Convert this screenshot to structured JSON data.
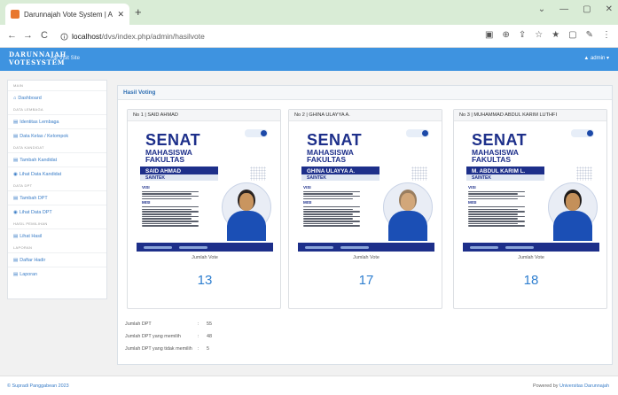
{
  "browser": {
    "tab_title": "Darunnajah Vote System | Admi",
    "tab_close": "✕",
    "new_tab": "+",
    "window_controls": [
      "⌄",
      "—",
      "▢",
      "✕"
    ],
    "back": "←",
    "forward": "→",
    "reload": "C",
    "url_host": "localhost",
    "url_path": "/dvs/index.php/admin/hasilvote",
    "addr_icons": [
      "▣",
      "⊕",
      "⇪",
      "☆",
      "★",
      "▢",
      "✎",
      "⋮"
    ]
  },
  "navbar": {
    "brand_line1": "DARUNNAJAH",
    "brand_line2": "VOTESYSTEM",
    "visit_site": "Visit Site",
    "user": "admin"
  },
  "sidebar": {
    "items": [
      {
        "type": "header",
        "label": "MAIN"
      },
      {
        "type": "link",
        "icon": "home-icon",
        "label": "Dashboard"
      },
      {
        "type": "header",
        "label": "DATA LEMBAGA"
      },
      {
        "type": "link",
        "icon": "list-icon",
        "label": "Identitas Lembaga"
      },
      {
        "type": "link",
        "icon": "list-icon",
        "label": "Data Kelas / Kelompok"
      },
      {
        "type": "header",
        "label": "DATA KANDIDAT"
      },
      {
        "type": "link",
        "icon": "list-icon",
        "label": "Tambah Kandidat"
      },
      {
        "type": "link",
        "icon": "eye-icon",
        "label": "Lihat Data Kandidat"
      },
      {
        "type": "header",
        "label": "DATA DPT"
      },
      {
        "type": "link",
        "icon": "list-icon",
        "label": "Tambah DPT"
      },
      {
        "type": "link",
        "icon": "eye-icon",
        "label": "Lihat Data DPT"
      },
      {
        "type": "header",
        "label": "HASIL PEMILIHAN"
      },
      {
        "type": "link",
        "icon": "list-icon",
        "label": "Lihat Hasil"
      },
      {
        "type": "header",
        "label": "LAPORAN"
      },
      {
        "type": "link",
        "icon": "list-icon",
        "label": "Daftar Hadir"
      },
      {
        "type": "link",
        "icon": "list-icon",
        "label": "Laporan"
      }
    ]
  },
  "main": {
    "title": "Hasil Voting",
    "candidates": [
      {
        "header": "No 1 | SAID AHMAD",
        "poster_name": "SAID AHMAD",
        "dept": "SAINTEK",
        "vote_label": "Jumlah Vote",
        "votes": "13"
      },
      {
        "header": "No 2 | GHINA ULAYYA A.",
        "poster_name": "GHINA ULAYYA A.",
        "dept": "SAINTEK",
        "vote_label": "Jumlah Vote",
        "votes": "17"
      },
      {
        "header": "No 3 | MUHAMMAD ABDUL KARIM LUTHFI",
        "poster_name": "M. ABDUL KARIM L.",
        "dept": "SAINTEK",
        "vote_label": "Jumlah Vote",
        "votes": "18"
      }
    ],
    "poster": {
      "title": "SENAT",
      "sub1": "MAHASISWA",
      "sub2": "FAKULTAS",
      "visi": "VISI",
      "misi": "MISI"
    },
    "stats": [
      {
        "label": "Jumlah DPT",
        "value": "55"
      },
      {
        "label": "Jumlah DPT yang memilih",
        "value": "48"
      },
      {
        "label": "Jumlah DPT yang tidak memilih",
        "value": "5"
      }
    ]
  },
  "footer": {
    "copyright": "© Supradi Panggabean 2023",
    "powered_prefix": "Powered by",
    "powered_by": "Universitas Darunnajah"
  },
  "colors": {
    "navbar": "#3e93e0",
    "link": "#3a7dc7",
    "poster_navy": "#1d2f8a",
    "tabbar": "#d9ecd6"
  }
}
